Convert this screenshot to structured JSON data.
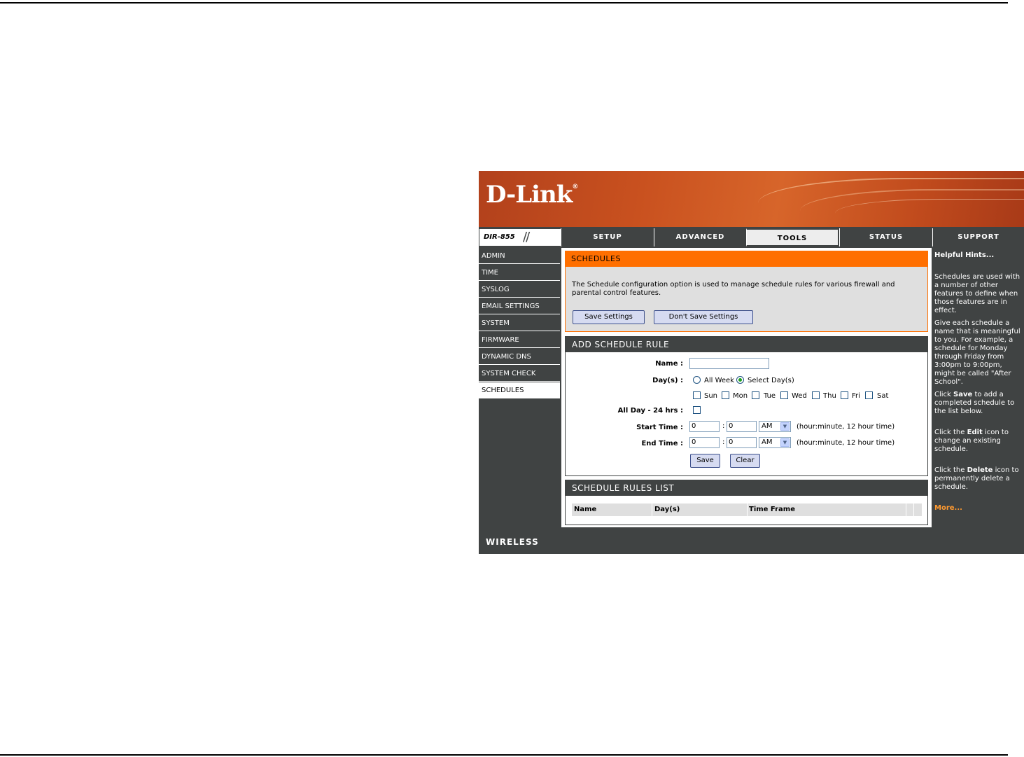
{
  "brand": {
    "logo": "D-Link",
    "model": "DIR-855"
  },
  "tabs": [
    "SETUP",
    "ADVANCED",
    "TOOLS",
    "STATUS",
    "SUPPORT"
  ],
  "active_tab": "TOOLS",
  "left_nav": [
    "ADMIN",
    "TIME",
    "SYSLOG",
    "EMAIL SETTINGS",
    "SYSTEM",
    "FIRMWARE",
    "DYNAMIC DNS",
    "SYSTEM CHECK",
    "SCHEDULES"
  ],
  "active_nav": "SCHEDULES",
  "schedules": {
    "title": "SCHEDULES",
    "description": "The Schedule configuration option is used to manage schedule rules for various firewall and parental control features.",
    "save_label": "Save Settings",
    "dont_save_label": "Don't Save Settings"
  },
  "add_rule": {
    "title": "ADD SCHEDULE RULE",
    "name_label": "Name :",
    "name_value": "",
    "days_label": "Day(s) :",
    "all_week": "All Week",
    "select_days": "Select Day(s)",
    "days": [
      "Sun",
      "Mon",
      "Tue",
      "Wed",
      "Thu",
      "Fri",
      "Sat"
    ],
    "all_day_label": "All Day - 24 hrs :",
    "start_label": "Start Time :",
    "end_label": "End Time :",
    "start_hour": "0",
    "start_min": "0",
    "start_ampm": "AM",
    "end_hour": "0",
    "end_min": "0",
    "end_ampm": "AM",
    "colon": ":",
    "time_hint": "(hour:minute, 12 hour time)",
    "save": "Save",
    "clear": "Clear"
  },
  "rules_list": {
    "title": "SCHEDULE RULES LIST",
    "columns": [
      "Name",
      "Day(s)",
      "Time Frame"
    ]
  },
  "hints": {
    "title": "Helpful Hints...",
    "p1": "Schedules are used with a number of other features to define when those features are in effect.",
    "p2": "Give each schedule a name that is meaningful to you. For example, a schedule for Monday through Friday from 3:00pm to 9:00pm, might be called \"After School\".",
    "p3_pre": "Click ",
    "p3_bold": "Save",
    "p3_post": " to add a completed schedule to the list below.",
    "p4_pre": "Click the ",
    "p4_bold": "Edit",
    "p4_post": " icon to change an existing schedule.",
    "p5_pre": "Click the ",
    "p5_bold": "Delete",
    "p5_post": " icon to permanently delete a schedule.",
    "more": "More..."
  },
  "footer": "WIRELESS",
  "colors": {
    "orange": "#ff6f00",
    "dark": "#404343",
    "button": "#d6dbf1"
  }
}
